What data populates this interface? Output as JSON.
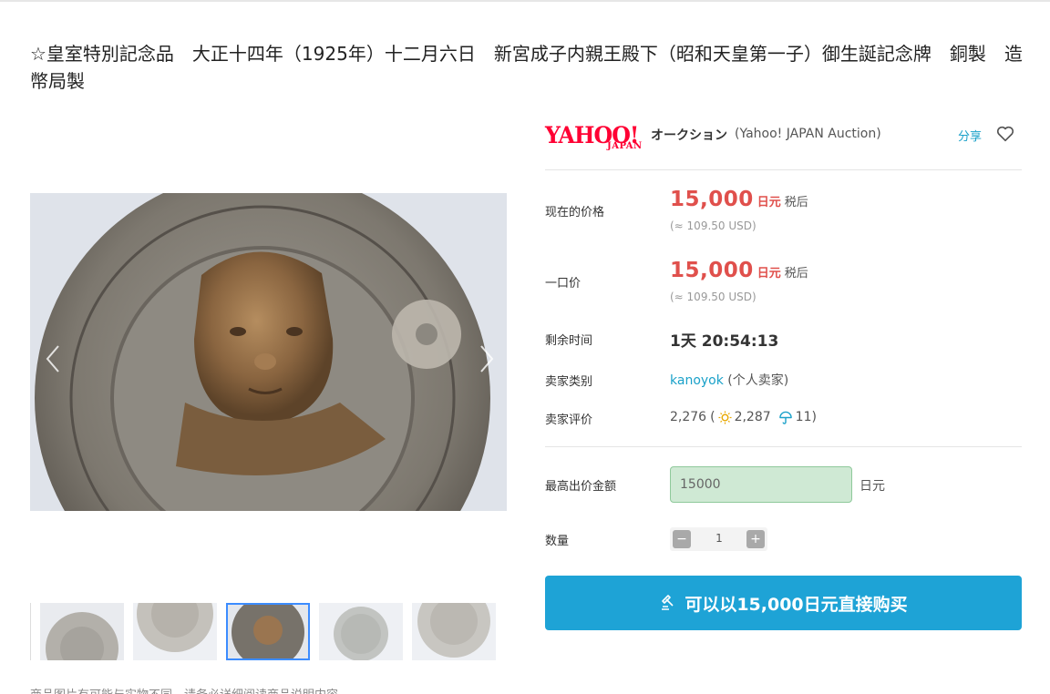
{
  "listing": {
    "title": "☆皇室特別記念品　大正十四年（1925年）十二月六日　新宮成子内親王殿下（昭和天皇第一子）御生誕記念牌　銅製　造幣局製"
  },
  "gallery": {
    "main_image_alt": "",
    "thumbnail_count": 5,
    "active_thumbnail_index": 2,
    "notice": "商品图片有可能与实物不同，请务必详细阅读商品说明内容"
  },
  "brand": {
    "logo_text": "YAHOO!",
    "logo_sub": "JAPAN",
    "auction_label": "オークション",
    "auction_en": "(Yahoo! JAPAN Auction)",
    "share_label": "分享",
    "accent_color": "#ff0033"
  },
  "details": {
    "current_price_label": "现在的价格",
    "current_price": "15,000",
    "current_price_unit": "日元",
    "current_price_tax": "税后",
    "current_price_usd": "(≈ 109.50 USD)",
    "buyout_label": "一口价",
    "buyout_price": "15,000",
    "buyout_unit": "日元",
    "buyout_tax": "税后",
    "buyout_usd": "(≈ 109.50 USD)",
    "time_left_label": "剩余时间",
    "time_left": "1天 20:54:13",
    "seller_type_label": "卖家类别",
    "seller_name": "kanoyok",
    "seller_type": "(个人卖家)",
    "seller_rating_label": "卖家评价",
    "rating_total": "2,276",
    "rating_good": "2,287",
    "rating_bad": "11"
  },
  "bid": {
    "max_bid_label": "最高出价金额",
    "max_bid_value": "15000",
    "max_bid_unit": "日元",
    "quantity_label": "数量",
    "quantity_value": "1",
    "minus_symbol": "−",
    "plus_symbol": "+",
    "buy_now_label": "可以以15,000日元直接购买",
    "button_color": "#1ea3d6",
    "price_color": "#e0504c"
  }
}
